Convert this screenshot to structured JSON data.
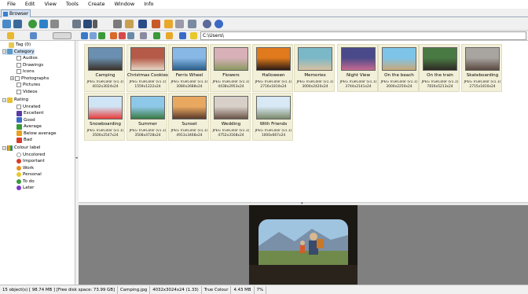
{
  "menu": [
    "File",
    "Edit",
    "View",
    "Tools",
    "Create",
    "Window",
    "Info"
  ],
  "tab": {
    "label": "Browser"
  },
  "address": {
    "value": "C:\\Users\\"
  },
  "tree": {
    "tag": "Tag (0)",
    "category": "Category",
    "category_items": [
      "Audios",
      "Drawings",
      "Icons",
      "Photographs",
      "Pictures",
      "Videos"
    ],
    "rating": "Rating",
    "rating_items": [
      "Unrated",
      "Excellent",
      "Good",
      "Average",
      "Below average",
      "Bad"
    ],
    "colour_label": "Colour label",
    "colour_items": [
      "Uncolored",
      "Important",
      "Work",
      "Personal",
      "To do",
      "Later"
    ]
  },
  "thumbnails": [
    {
      "name": "Camping",
      "format": "JPEG TrueColor (v1.1)",
      "dims": "4032x3024x24",
      "c1": "#6a8fb0",
      "c2": "#3a3228"
    },
    {
      "name": "Christmas Cookies",
      "format": "JPEG TrueColor (v1.1)",
      "dims": "1559x1222x24",
      "c1": "#b55a48",
      "c2": "#e8d7c4"
    },
    {
      "name": "Ferris Wheel",
      "format": "JPEG TrueColor (v1.1)",
      "dims": "3080x2688x24",
      "c1": "#88b8e6",
      "c2": "#2a5e8a"
    },
    {
      "name": "Flowers",
      "format": "JPEG TrueColor (v1.1)",
      "dims": "4438x2953x24",
      "c1": "#d8b0b8",
      "c2": "#8a9a60"
    },
    {
      "name": "Halloween",
      "format": "JPEG TrueColor (v1.1)",
      "dims": "2716x1810x24",
      "c1": "#e07a1c",
      "c2": "#2a1a14"
    },
    {
      "name": "Memories",
      "format": "JPEG TrueColor (v1.1)",
      "dims": "3000x2420x24",
      "c1": "#7ab8c8",
      "c2": "#d8c0a0"
    },
    {
      "name": "Night View",
      "format": "JPEG TrueColor (v1.1)",
      "dims": "3744x2141x24",
      "c1": "#4a4a8a",
      "c2": "#c86a90"
    },
    {
      "name": "On the beach",
      "format": "JPEG TrueColor (v1.1)",
      "dims": "3000x2250x24",
      "c1": "#7ec4e8",
      "c2": "#c8a878"
    },
    {
      "name": "On the train",
      "format": "JPEG TrueColor (v1.1)",
      "dims": "7816x5213x24",
      "c1": "#4a7a44",
      "c2": "#2e2a24"
    },
    {
      "name": "Skateboarding",
      "format": "JPEG TrueColor (v1.1)",
      "dims": "2715x1810x24",
      "c1": "#a8a4a0",
      "c2": "#5a4a40"
    },
    {
      "name": "Snowboarding",
      "format": "JPEG TrueColor (v1.1)",
      "dims": "3500x2547x24",
      "c1": "#cfe4f4",
      "c2": "#e83a3a"
    },
    {
      "name": "Summer",
      "format": "JPEG TrueColor (v1.1)",
      "dims": "3508x4728x24",
      "c1": "#8ec8e8",
      "c2": "#3a7a44"
    },
    {
      "name": "Sunset",
      "format": "JPEG TrueColor (v1.1)",
      "dims": "4913x3468x24",
      "c1": "#e8a860",
      "c2": "#5a3a2a"
    },
    {
      "name": "Wedding",
      "format": "JPEG TrueColor (v1.1)",
      "dims": "4752x3168x24",
      "c1": "#d8d0c8",
      "c2": "#6a5448"
    },
    {
      "name": "With Friends",
      "format": "JPEG TrueColor (v1.1)",
      "dims": "1000x667x24",
      "c1": "#d8e8f4",
      "c2": "#7a8a6a"
    }
  ],
  "status": {
    "objects": "15 object(s) [ 98.74 MB ] [Free disk space: 73.99 GB]",
    "file": "Camping.jpg",
    "dims": "4032x3024x24 (1.33)",
    "colour": "True Colour",
    "size": "4.43 MB",
    "zoom": "7%"
  },
  "colors": {
    "selection": "#f2f0d8",
    "tree_bg": "#ffffff",
    "preview_bg": "#808080"
  }
}
